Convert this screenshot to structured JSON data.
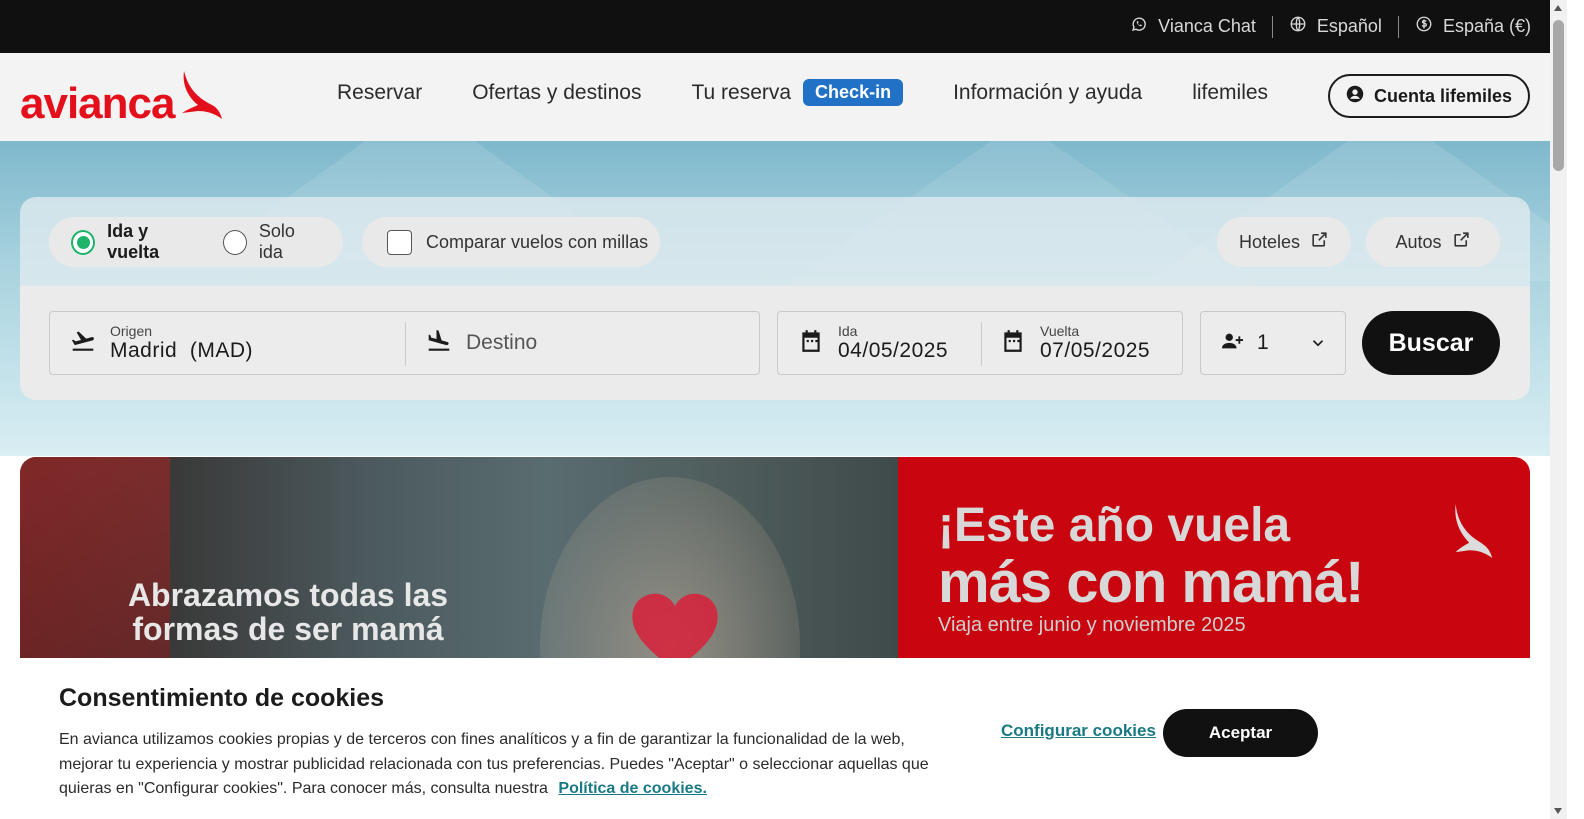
{
  "topbar": {
    "chat_label": "Vianca Chat",
    "language_label": "Español",
    "region_label": "España (€)"
  },
  "nav": {
    "logo_text": "avianca",
    "links": {
      "book": "Reservar",
      "offers": "Ofertas y destinos",
      "my_booking": "Tu reserva",
      "checkin": "Check-in",
      "info": "Información y ayuda",
      "lifemiles": "lifemiles"
    },
    "account_label": "Cuenta lifemiles"
  },
  "search": {
    "trip_round": "Ida y vuelta",
    "trip_oneway": "Solo ida",
    "compare_miles": "Comparar vuelos con millas",
    "hotels": "Hoteles",
    "cars": "Autos",
    "origin_label": "Origen",
    "origin_value": "Madrid  (MAD)",
    "destination_placeholder": "Destino",
    "depart_label": "Ida",
    "depart_value": "04/05/2025",
    "return_label": "Vuelta",
    "return_value": "07/05/2025",
    "passengers": "1",
    "search_button": "Buscar"
  },
  "promo": {
    "photo_caption": "Abrazamos todas las formas de ser mamá",
    "headline_1": "¡Este año vuela",
    "headline_2": "más con mamá!",
    "subline": "Viaja entre junio y noviembre 2025"
  },
  "cookies": {
    "title": "Consentimiento de cookies",
    "body": "En avianca utilizamos cookies propias y de terceros con fines analíticos y a fin de garantizar la funcionalidad de la web, mejorar tu experiencia y mostrar publicidad relacionada con tus preferencias. Puedes \"Aceptar\" o seleccionar aquellas que quieras en \"Configurar cookies\". Para conocer más, consulta nuestra",
    "policy_link": "Política de cookies.",
    "configure_link": "Configurar cookies",
    "accept_button": "Aceptar"
  },
  "colors": {
    "brand_red": "#e3101b",
    "checkin_blue": "#2172c6",
    "radio_green": "#1db46a",
    "link_teal": "#1a7a84"
  }
}
